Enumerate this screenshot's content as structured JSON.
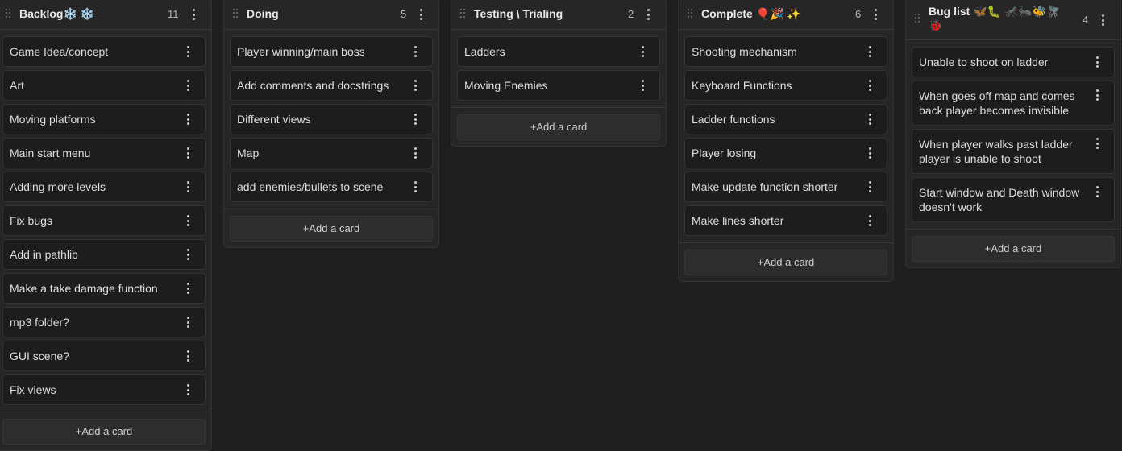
{
  "add_card_label": "+Add a card",
  "columns": [
    {
      "title": "Backlog❄️ ❄️",
      "count": "11",
      "cards": [
        "Game Idea/concept",
        "Art",
        "Moving platforms",
        "Main start menu",
        "Adding more levels",
        "Fix bugs",
        "Add in pathlib",
        "Make a take damage function",
        "mp3 folder?",
        "GUI scene?",
        "Fix views"
      ]
    },
    {
      "title": "Doing",
      "count": "5",
      "cards": [
        "Player winning/main boss",
        "Add comments and docstrings",
        "Different views",
        "Map",
        "add enemies/bullets to scene"
      ]
    },
    {
      "title": "Testing \\ Trialing",
      "count": "2",
      "cards": [
        "Ladders",
        "Moving Enemies"
      ]
    },
    {
      "title": "Complete 🎈🎉 ✨",
      "count": "6",
      "cards": [
        "Shooting mechanism",
        "Keyboard Functions",
        "Ladder functions",
        "Player losing",
        "Make update function shorter",
        "Make lines shorter"
      ]
    },
    {
      "title": "Bug list 🦋🐛 🦟🐜🐝🪰 🐞",
      "count": "4",
      "cards": [
        "Unable to shoot on ladder",
        "When goes off map and comes back player becomes invisible",
        "When player walks past ladder player is unable to shoot",
        "Start window and Death window doesn't work"
      ]
    }
  ]
}
